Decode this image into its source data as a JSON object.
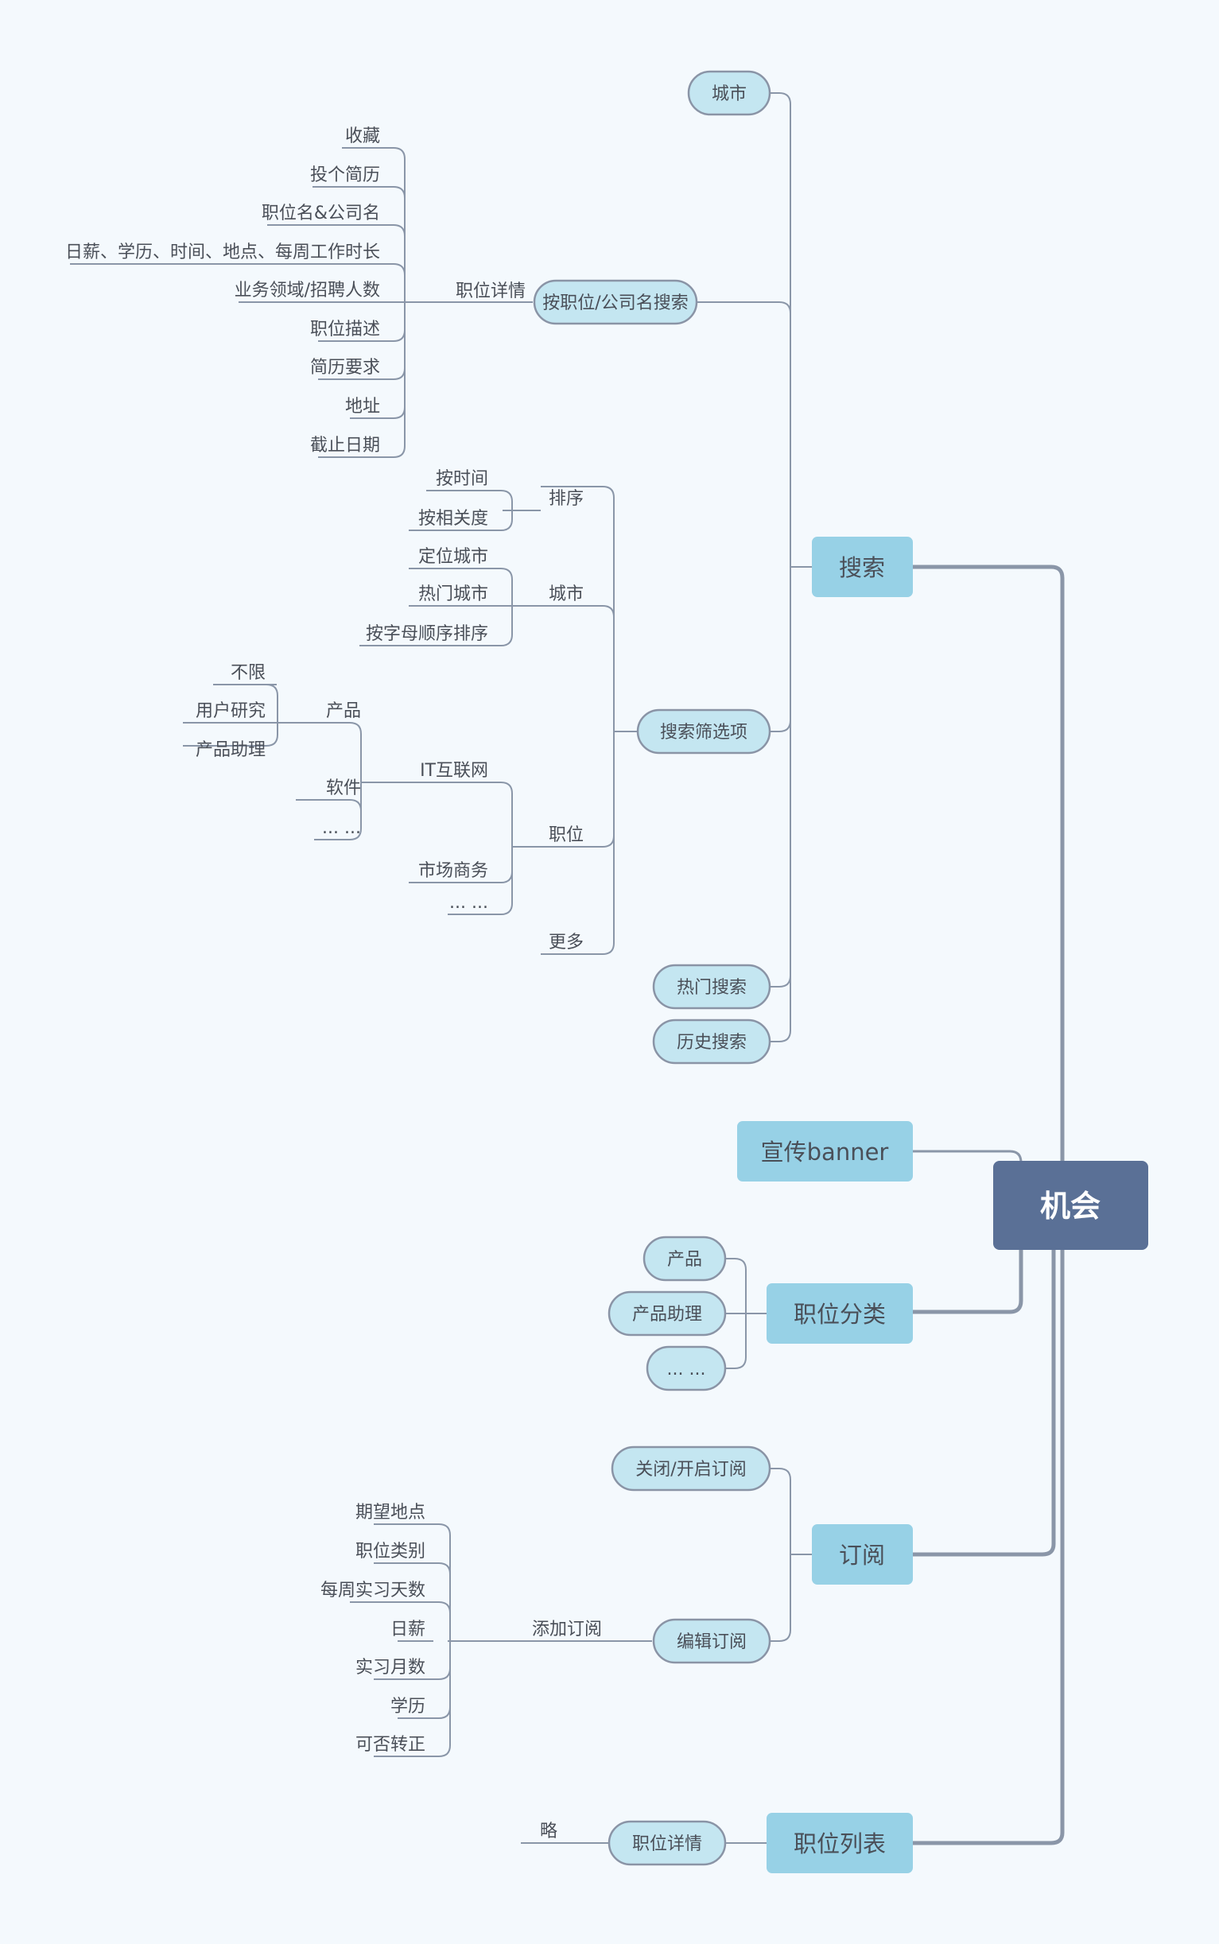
{
  "root": {
    "label": "机会"
  },
  "search": {
    "label": "搜索",
    "city": "城市",
    "by_name": {
      "label": "按职位/公司名搜索",
      "detail_label": "职位详情",
      "detail_items": [
        "收藏",
        "投个简历",
        "职位名&公司名",
        "日薪、学历、时间、地点、每周工作时长",
        "业务领域/招聘人数",
        "职位描述",
        "简历要求",
        "地址",
        "截止日期"
      ]
    },
    "filters": {
      "label": "搜索筛选项",
      "sort": {
        "label": "排序",
        "items": [
          "按时间",
          "按相关度"
        ]
      },
      "city": {
        "label": "城市",
        "items": [
          "定位城市",
          "热门城市",
          "按字母顺序排序"
        ]
      },
      "position": {
        "label": "职位",
        "it": {
          "label": "IT互联网",
          "product": {
            "label": "产品",
            "items": [
              "不限",
              "用户研究",
              "产品助理"
            ]
          },
          "software": "软件",
          "more": "... ..."
        },
        "marketing": "市场商务",
        "more": "... ..."
      },
      "more": "更多"
    },
    "hot": "热门搜索",
    "history": "历史搜索"
  },
  "banner": {
    "label": "宣传banner"
  },
  "category": {
    "label": "职位分类",
    "items": [
      "产品",
      "产品助理",
      "... ..."
    ]
  },
  "subscribe": {
    "label": "订阅",
    "toggle": "关闭/开启订阅",
    "edit": "编辑订阅",
    "add": {
      "label": "添加订阅",
      "items": [
        "期望地点",
        "职位类别",
        "每周实习天数",
        "日薪",
        "实习月数",
        "学历",
        "可否转正"
      ]
    }
  },
  "job_list": {
    "label": "职位列表",
    "detail": "职位详情",
    "omitted": "略"
  }
}
